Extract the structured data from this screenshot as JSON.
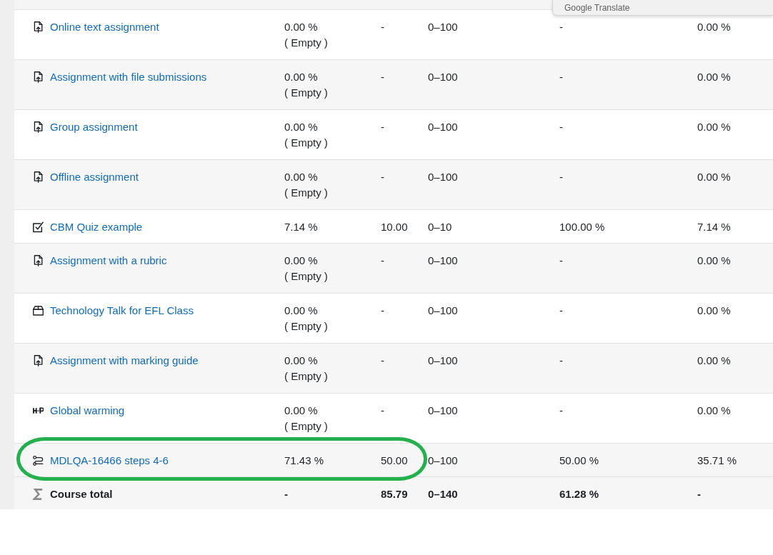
{
  "popup": {
    "title": "Google Translate"
  },
  "rows": [
    {
      "kind": "upload",
      "name": "Online text assignment",
      "highlighted": false,
      "cells": [
        {
          "text": "0.00 %",
          "note": "( Empty )"
        },
        {
          "text": "-"
        },
        {
          "text": "0–100"
        },
        {
          "text": "-"
        },
        {
          "text": "0.00 %"
        }
      ]
    },
    {
      "kind": "upload",
      "name": "Assignment with file submissions",
      "highlighted": false,
      "cells": [
        {
          "text": "0.00 %",
          "note": "( Empty )"
        },
        {
          "text": "-"
        },
        {
          "text": "0–100"
        },
        {
          "text": "-"
        },
        {
          "text": "0.00 %"
        }
      ]
    },
    {
      "kind": "upload",
      "name": "Group assignment",
      "highlighted": false,
      "cells": [
        {
          "text": "0.00 %",
          "note": "( Empty )"
        },
        {
          "text": "-"
        },
        {
          "text": "0–100"
        },
        {
          "text": "-"
        },
        {
          "text": "0.00 %"
        }
      ]
    },
    {
      "kind": "upload",
      "name": "Offline assignment",
      "highlighted": false,
      "cells": [
        {
          "text": "0.00 %",
          "note": "( Empty )"
        },
        {
          "text": "-"
        },
        {
          "text": "0–100"
        },
        {
          "text": "-"
        },
        {
          "text": "0.00 %"
        }
      ]
    },
    {
      "kind": "quiz",
      "name": "CBM Quiz example",
      "highlighted": false,
      "cells": [
        {
          "text": "7.14 %"
        },
        {
          "text": "10.00"
        },
        {
          "text": "0–10"
        },
        {
          "text": "100.00 %"
        },
        {
          "text": "7.14 %"
        }
      ]
    },
    {
      "kind": "upload",
      "name": "Assignment with a rubric",
      "highlighted": false,
      "cells": [
        {
          "text": "0.00 %",
          "note": "( Empty )"
        },
        {
          "text": "-"
        },
        {
          "text": "0–100"
        },
        {
          "text": "-"
        },
        {
          "text": "0.00 %"
        }
      ]
    },
    {
      "kind": "box",
      "name": "Technology Talk for EFL Class",
      "highlighted": false,
      "cells": [
        {
          "text": "0.00 %",
          "note": "( Empty )"
        },
        {
          "text": "-"
        },
        {
          "text": "0–100"
        },
        {
          "text": "-"
        },
        {
          "text": "0.00 %"
        }
      ]
    },
    {
      "kind": "upload",
      "name": "Assignment with marking guide",
      "highlighted": false,
      "cells": [
        {
          "text": "0.00 %",
          "note": "( Empty )"
        },
        {
          "text": "-"
        },
        {
          "text": "0–100"
        },
        {
          "text": "-"
        },
        {
          "text": "0.00 %"
        }
      ]
    },
    {
      "kind": "logo",
      "name": "Global warming",
      "highlighted": false,
      "cells": [
        {
          "text": "0.00 %",
          "note": "( Empty )"
        },
        {
          "text": "-"
        },
        {
          "text": "0–100"
        },
        {
          "text": "-"
        },
        {
          "text": "0.00 %"
        }
      ]
    },
    {
      "kind": "route",
      "name": "MDLQA-16466 steps 4-6",
      "highlighted": true,
      "cells": [
        {
          "text": "71.43 %"
        },
        {
          "text": "50.00"
        },
        {
          "text": "0–100"
        },
        {
          "text": "50.00 %"
        },
        {
          "text": "35.71 %"
        }
      ]
    },
    {
      "kind": "total",
      "name": "Course total",
      "highlighted": false,
      "cells": [
        {
          "text": "-"
        },
        {
          "text": "85.79"
        },
        {
          "text": "0–140"
        },
        {
          "text": "61.28 %"
        },
        {
          "text": "-"
        }
      ]
    }
  ]
}
